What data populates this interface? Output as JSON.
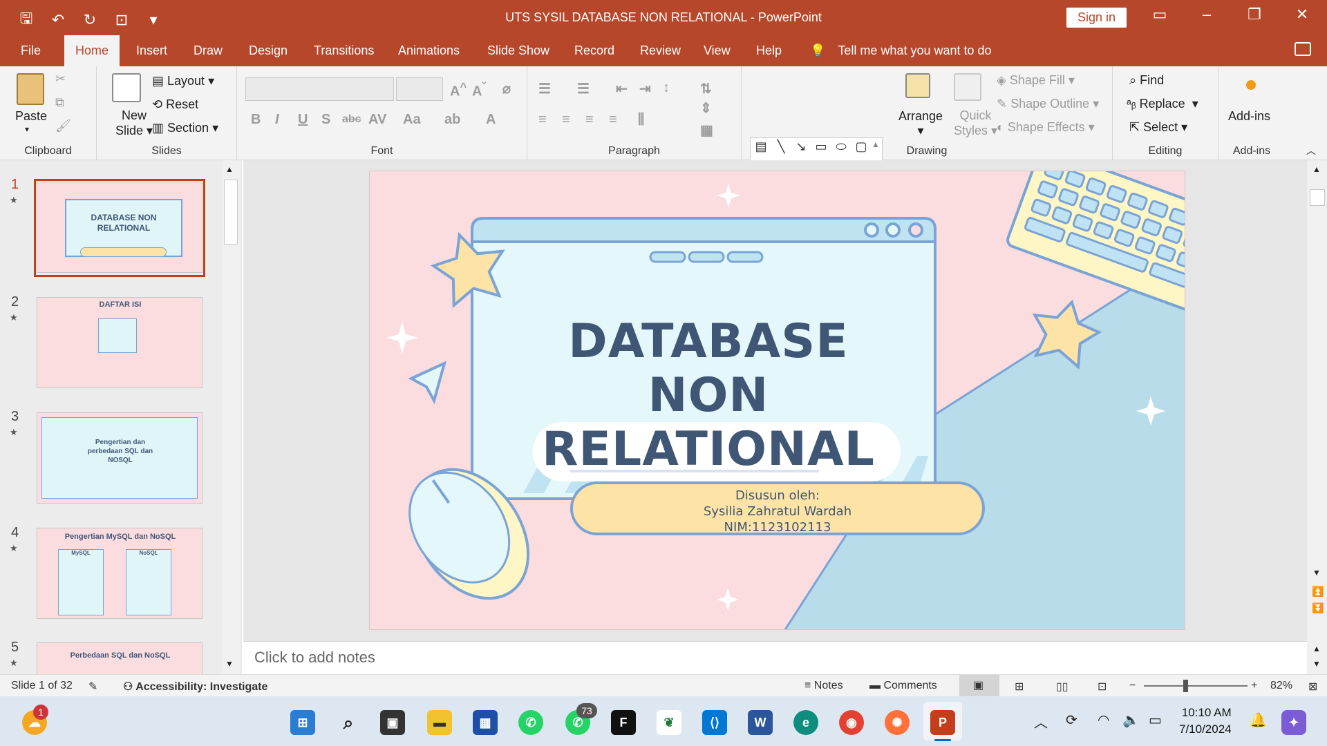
{
  "window": {
    "title": "UTS SYSIL DATABASE NON RELATIONAL  -  PowerPoint",
    "sign_in": "Sign in"
  },
  "tabs": [
    "File",
    "Home",
    "Insert",
    "Draw",
    "Design",
    "Transitions",
    "Animations",
    "Slide Show",
    "Record",
    "Review",
    "View",
    "Help"
  ],
  "active_tab": "Home",
  "tell_me": "Tell me what you want to do",
  "ribbon": {
    "clipboard": {
      "paste": "Paste",
      "label": "Clipboard"
    },
    "slides": {
      "new_slide_1": "New",
      "new_slide_2": "Slide",
      "layout": "Layout",
      "reset": "Reset",
      "section": "Section",
      "label": "Slides"
    },
    "font": {
      "label": "Font"
    },
    "paragraph": {
      "label": "Paragraph"
    },
    "drawing": {
      "arrange": "Arrange",
      "quick_styles_1": "Quick",
      "quick_styles_2": "Styles",
      "shape_fill": "Shape Fill",
      "shape_outline": "Shape Outline",
      "shape_effects": "Shape Effects",
      "label": "Drawing"
    },
    "editing": {
      "find": "Find",
      "replace": "Replace",
      "select": "Select",
      "label": "Editing"
    },
    "addins": {
      "button": "Add-ins",
      "label": "Add-ins"
    }
  },
  "thumbnails": [
    {
      "num": "1",
      "title": "DATABASE NON RELATIONAL"
    },
    {
      "num": "2",
      "title": "DAFTAR ISI"
    },
    {
      "num": "3",
      "title": "Pengertian dan perbedaan SQL dan NOSQL"
    },
    {
      "num": "4",
      "title": "Pengertian MySQL dan NoSQL",
      "col1": "MySQL",
      "col2": "NoSQL"
    },
    {
      "num": "5",
      "title": "Perbedaan SQL dan NoSQL"
    }
  ],
  "slide": {
    "title_line1": "DATABASE NON",
    "title_line2": "RELATIONAL",
    "sub1": "Disusun oleh:",
    "sub2": "Sysilia Zahratul Wardah",
    "sub3": "NIM:1123102113"
  },
  "notes_placeholder": "Click to add notes",
  "status": {
    "slide": "Slide 1 of 32",
    "accessibility": "Accessibility: Investigate",
    "notes": "Notes",
    "comments": "Comments",
    "zoom": "82%"
  },
  "taskbar": {
    "weather_badge": "1",
    "whatsapp_badge": "73",
    "time": "10:10 AM",
    "date": "7/10/2024"
  },
  "colors": {
    "accent": "#b7472a",
    "slide_bg": "#fbdde0",
    "title_text": "#3f5675",
    "pill": "#fde4a6"
  }
}
